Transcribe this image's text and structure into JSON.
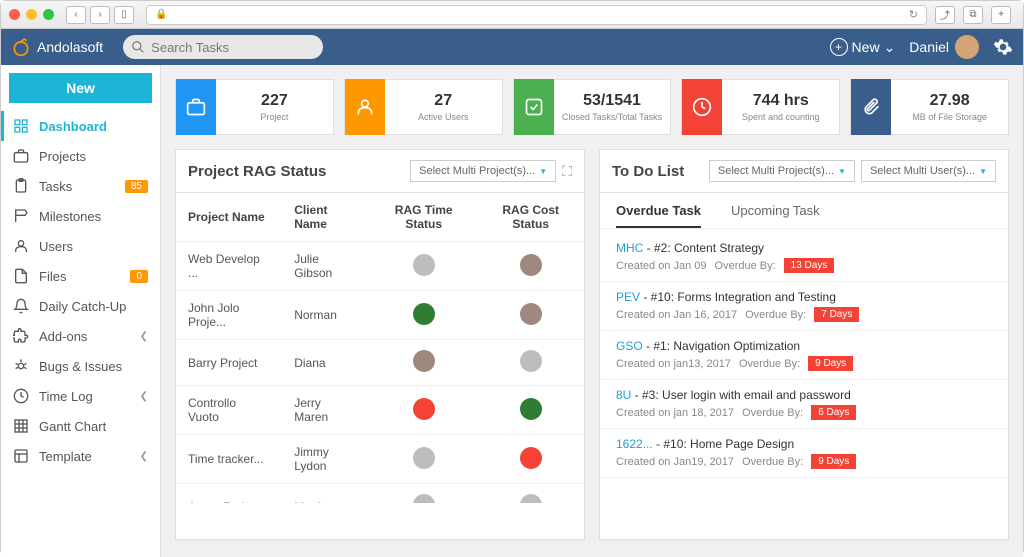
{
  "app": {
    "name": "Andolasoft",
    "search_placeholder": "Search Tasks",
    "new_label": "New",
    "user": "Daniel"
  },
  "sidebar": {
    "new_btn": "New",
    "items": [
      {
        "icon": "dashboard",
        "label": "Dashboard",
        "active": true
      },
      {
        "icon": "briefcase",
        "label": "Projects"
      },
      {
        "icon": "clipboard",
        "label": "Tasks",
        "badge": "85"
      },
      {
        "icon": "milestone",
        "label": "Milestones"
      },
      {
        "icon": "user",
        "label": "Users"
      },
      {
        "icon": "file",
        "label": "Files",
        "badge": "0"
      },
      {
        "icon": "bell",
        "label": "Daily Catch-Up"
      },
      {
        "icon": "puzzle",
        "label": "Add-ons",
        "chev": true
      },
      {
        "icon": "bug",
        "label": "Bugs & Issues"
      },
      {
        "icon": "clock",
        "label": "Time Log",
        "chev": true
      },
      {
        "icon": "grid",
        "label": "Gantt Chart"
      },
      {
        "icon": "template",
        "label": "Template",
        "chev": true
      }
    ]
  },
  "stats": [
    {
      "color": "#2196f3",
      "icon": "briefcase",
      "value": "227",
      "label": "Project"
    },
    {
      "color": "#ff9800",
      "icon": "user",
      "value": "27",
      "label": "Active Users"
    },
    {
      "color": "#4caf50",
      "icon": "check",
      "value": "53/1541",
      "label": "Closed Tasks/Total Tasks"
    },
    {
      "color": "#f44336",
      "icon": "clock",
      "value": "744 hrs",
      "label": "Spent and counting"
    },
    {
      "color": "#3a5e8c",
      "icon": "attach",
      "value": "27.98",
      "label": "MB of File Storage"
    }
  ],
  "rag": {
    "title": "Project RAG Status",
    "select": "Select Multi Project(s)...",
    "headers": {
      "p": "Project Name",
      "c": "Client Name",
      "t": "RAG Time Status",
      "co": "RAG Cost Status"
    },
    "rows": [
      {
        "p": "Web Develop ...",
        "c": "Julie Gibson",
        "t": "#bdbdbd",
        "co": "#a1887f"
      },
      {
        "p": "John Jolo Proje...",
        "c": "Norman",
        "t": "#2e7d32",
        "co": "#a1887f"
      },
      {
        "p": "Barry Project",
        "c": "Diana",
        "t": "#a1887f",
        "co": "#bdbdbd"
      },
      {
        "p": "Controllo Vuoto",
        "c": "Jerry Maren",
        "t": "#f44336",
        "co": "#2e7d32"
      },
      {
        "p": "Time tracker...",
        "c": "Jimmy Lydon",
        "t": "#bdbdbd",
        "co": "#f44336"
      },
      {
        "p": "Aaron Project",
        "c": "Martin",
        "t": "#bdbdbd",
        "co": "#bdbdbd"
      }
    ]
  },
  "todo": {
    "title": "To Do List",
    "select1": "Select Multi Project(s)...",
    "select2": "Select Multi User(s)...",
    "tabs": {
      "overdue": "Overdue Task",
      "upcoming": "Upcoming Task"
    },
    "items": [
      {
        "code": "MHC",
        "title": "#2: Content Strategy",
        "created": "Created on Jan 09",
        "overdue": "Overdue By:",
        "days": "13 Days"
      },
      {
        "code": "PEV",
        "title": "#10: Forms Integration and Testing",
        "created": "Created on Jan 16, 2017",
        "overdue": "Overdue By:",
        "days": "7 Days"
      },
      {
        "code": "GSO",
        "title": "#1: Navigation Optimization",
        "created": "Created on jan13, 2017",
        "overdue": "Overdue By:",
        "days": "9 Days"
      },
      {
        "code": "8U",
        "title": "#3: User login with email and password",
        "created": "Created on jan 18, 2017",
        "overdue": "Overdue By:",
        "days": "6 Days"
      },
      {
        "code": "1622...",
        "title": "#10: Home Page Design",
        "created": "Created on Jan19, 2017",
        "overdue": "Overdue By:",
        "days": "9 Days"
      }
    ]
  }
}
